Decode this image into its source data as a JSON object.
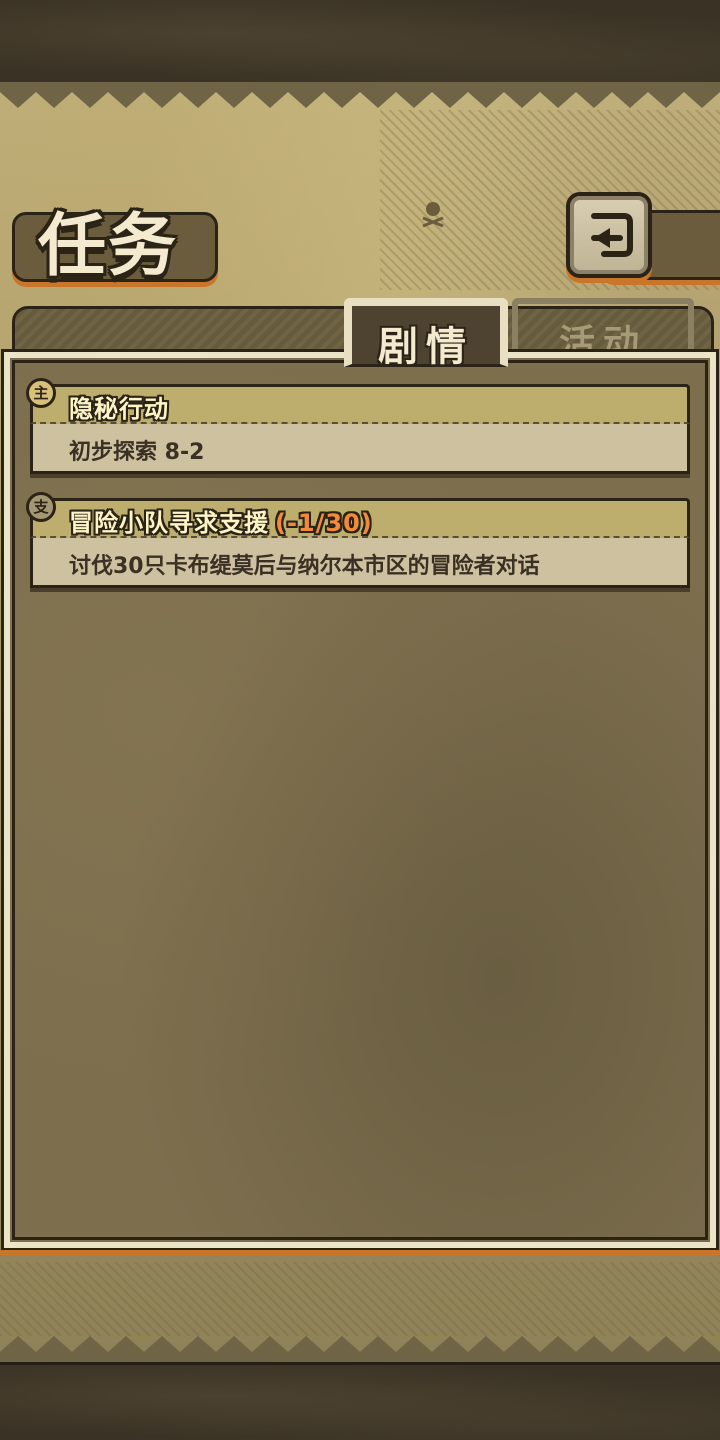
{
  "header": {
    "title": "任务",
    "back_icon": "back-arrow-icon"
  },
  "tabs": [
    {
      "label": "剧情",
      "active": true
    },
    {
      "label": "活动",
      "active": false
    }
  ],
  "quests": [
    {
      "type_badge": "主",
      "type": "main",
      "title": "隐秘行动",
      "progress": "",
      "description": "初步探索 8-2"
    },
    {
      "type_badge": "支",
      "type": "side",
      "title": "冒险小队寻求支援",
      "progress": "(-1/30)",
      "description": "讨伐30只卡布缇莫后与纳尔本市区的冒险者对话"
    }
  ],
  "colors": {
    "accent_orange": "#c9752a",
    "progress_orange": "#f28a3a",
    "outline": "#2b2416",
    "parchment": "#bfae7a"
  }
}
